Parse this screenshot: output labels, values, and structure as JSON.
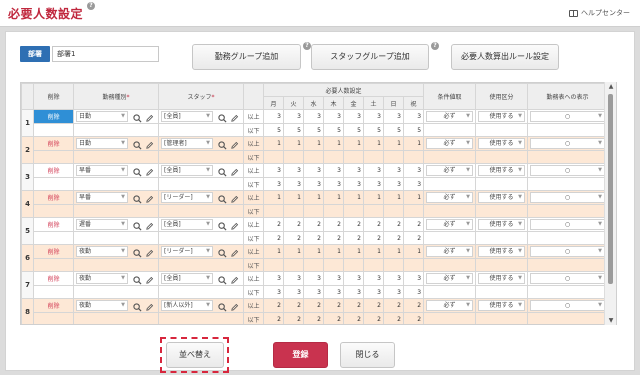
{
  "header": {
    "title": "必要人数設定",
    "help_center": "ヘルプセンター"
  },
  "department": {
    "badge": "部署",
    "value": "部署1"
  },
  "buttons": {
    "add_work_group": "勤務グループ追加",
    "add_staff_group": "スタッフグループ追加",
    "rule_settings": "必要人数算出ルール設定",
    "sort": "並べ替え",
    "register": "登録",
    "close": "閉じる"
  },
  "table": {
    "headers": {
      "delete": "削除",
      "work_type": "勤務種別",
      "staff": "スタッフ",
      "required_settings": "必要人数設定",
      "days": [
        "月",
        "火",
        "水",
        "木",
        "金",
        "土",
        "日",
        "祝"
      ],
      "condition": "条件値取",
      "usage": "使用区分",
      "display": "勤務表への表示"
    },
    "min_label": "以上",
    "max_label": "以下",
    "rows": [
      {
        "no": "1",
        "del": "削除",
        "work": "日勤",
        "staff": "[全員]",
        "min": [
          "3",
          "3",
          "3",
          "3",
          "3",
          "3",
          "3",
          "3"
        ],
        "max": [
          "5",
          "5",
          "5",
          "5",
          "5",
          "5",
          "5",
          "5"
        ],
        "cond": "必ず",
        "usage": "使用する",
        "display": "○",
        "alt": false,
        "selected": true
      },
      {
        "no": "2",
        "del": "削除",
        "work": "日勤",
        "staff": "[管理者]",
        "min": [
          "1",
          "1",
          "1",
          "1",
          "1",
          "1",
          "1",
          "1"
        ],
        "max": [
          "",
          "",
          "",
          "",
          "",
          "",
          "",
          ""
        ],
        "cond": "必ず",
        "usage": "使用する",
        "display": "○",
        "alt": true,
        "selected": false
      },
      {
        "no": "3",
        "del": "削除",
        "work": "早番",
        "staff": "[全員]",
        "min": [
          "3",
          "3",
          "3",
          "3",
          "3",
          "3",
          "3",
          "3"
        ],
        "max": [
          "3",
          "3",
          "3",
          "3",
          "3",
          "3",
          "3",
          "3"
        ],
        "cond": "必ず",
        "usage": "使用する",
        "display": "○",
        "alt": false,
        "selected": false
      },
      {
        "no": "4",
        "del": "削除",
        "work": "早番",
        "staff": "[リーダー]",
        "min": [
          "1",
          "1",
          "1",
          "1",
          "1",
          "1",
          "1",
          "1"
        ],
        "max": [
          "",
          "",
          "",
          "",
          "",
          "",
          "",
          ""
        ],
        "cond": "必ず",
        "usage": "使用する",
        "display": "○",
        "alt": true,
        "selected": false
      },
      {
        "no": "5",
        "del": "削除",
        "work": "遅番",
        "staff": "[全員]",
        "min": [
          "2",
          "2",
          "2",
          "2",
          "2",
          "2",
          "2",
          "2"
        ],
        "max": [
          "2",
          "2",
          "2",
          "2",
          "2",
          "2",
          "2",
          "2"
        ],
        "cond": "必ず",
        "usage": "使用する",
        "display": "○",
        "alt": false,
        "selected": false
      },
      {
        "no": "6",
        "del": "削除",
        "work": "夜勤",
        "staff": "[リーダー]",
        "min": [
          "1",
          "1",
          "1",
          "1",
          "1",
          "1",
          "1",
          "1"
        ],
        "max": [
          "",
          "",
          "",
          "",
          "",
          "",
          "",
          ""
        ],
        "cond": "必ず",
        "usage": "使用する",
        "display": "○",
        "alt": true,
        "selected": false
      },
      {
        "no": "7",
        "del": "削除",
        "work": "夜勤",
        "staff": "[全員]",
        "min": [
          "3",
          "3",
          "3",
          "3",
          "3",
          "3",
          "3",
          "3"
        ],
        "max": [
          "3",
          "3",
          "3",
          "3",
          "3",
          "3",
          "3",
          "3"
        ],
        "cond": "必ず",
        "usage": "使用する",
        "display": "○",
        "alt": false,
        "selected": false
      },
      {
        "no": "8",
        "del": "削除",
        "work": "夜勤",
        "staff": "[新人以外]",
        "min": [
          "2",
          "2",
          "2",
          "2",
          "2",
          "2",
          "2",
          "2"
        ],
        "max": [
          "2",
          "2",
          "2",
          "2",
          "2",
          "2",
          "2",
          "2"
        ],
        "cond": "必ず",
        "usage": "使用する",
        "display": "○",
        "alt": true,
        "selected": false
      }
    ]
  },
  "colors": {
    "brand": "#c0283e",
    "badge": "#2e6fb3",
    "register": "#c9334f",
    "alt_row": "#fde8d6"
  }
}
